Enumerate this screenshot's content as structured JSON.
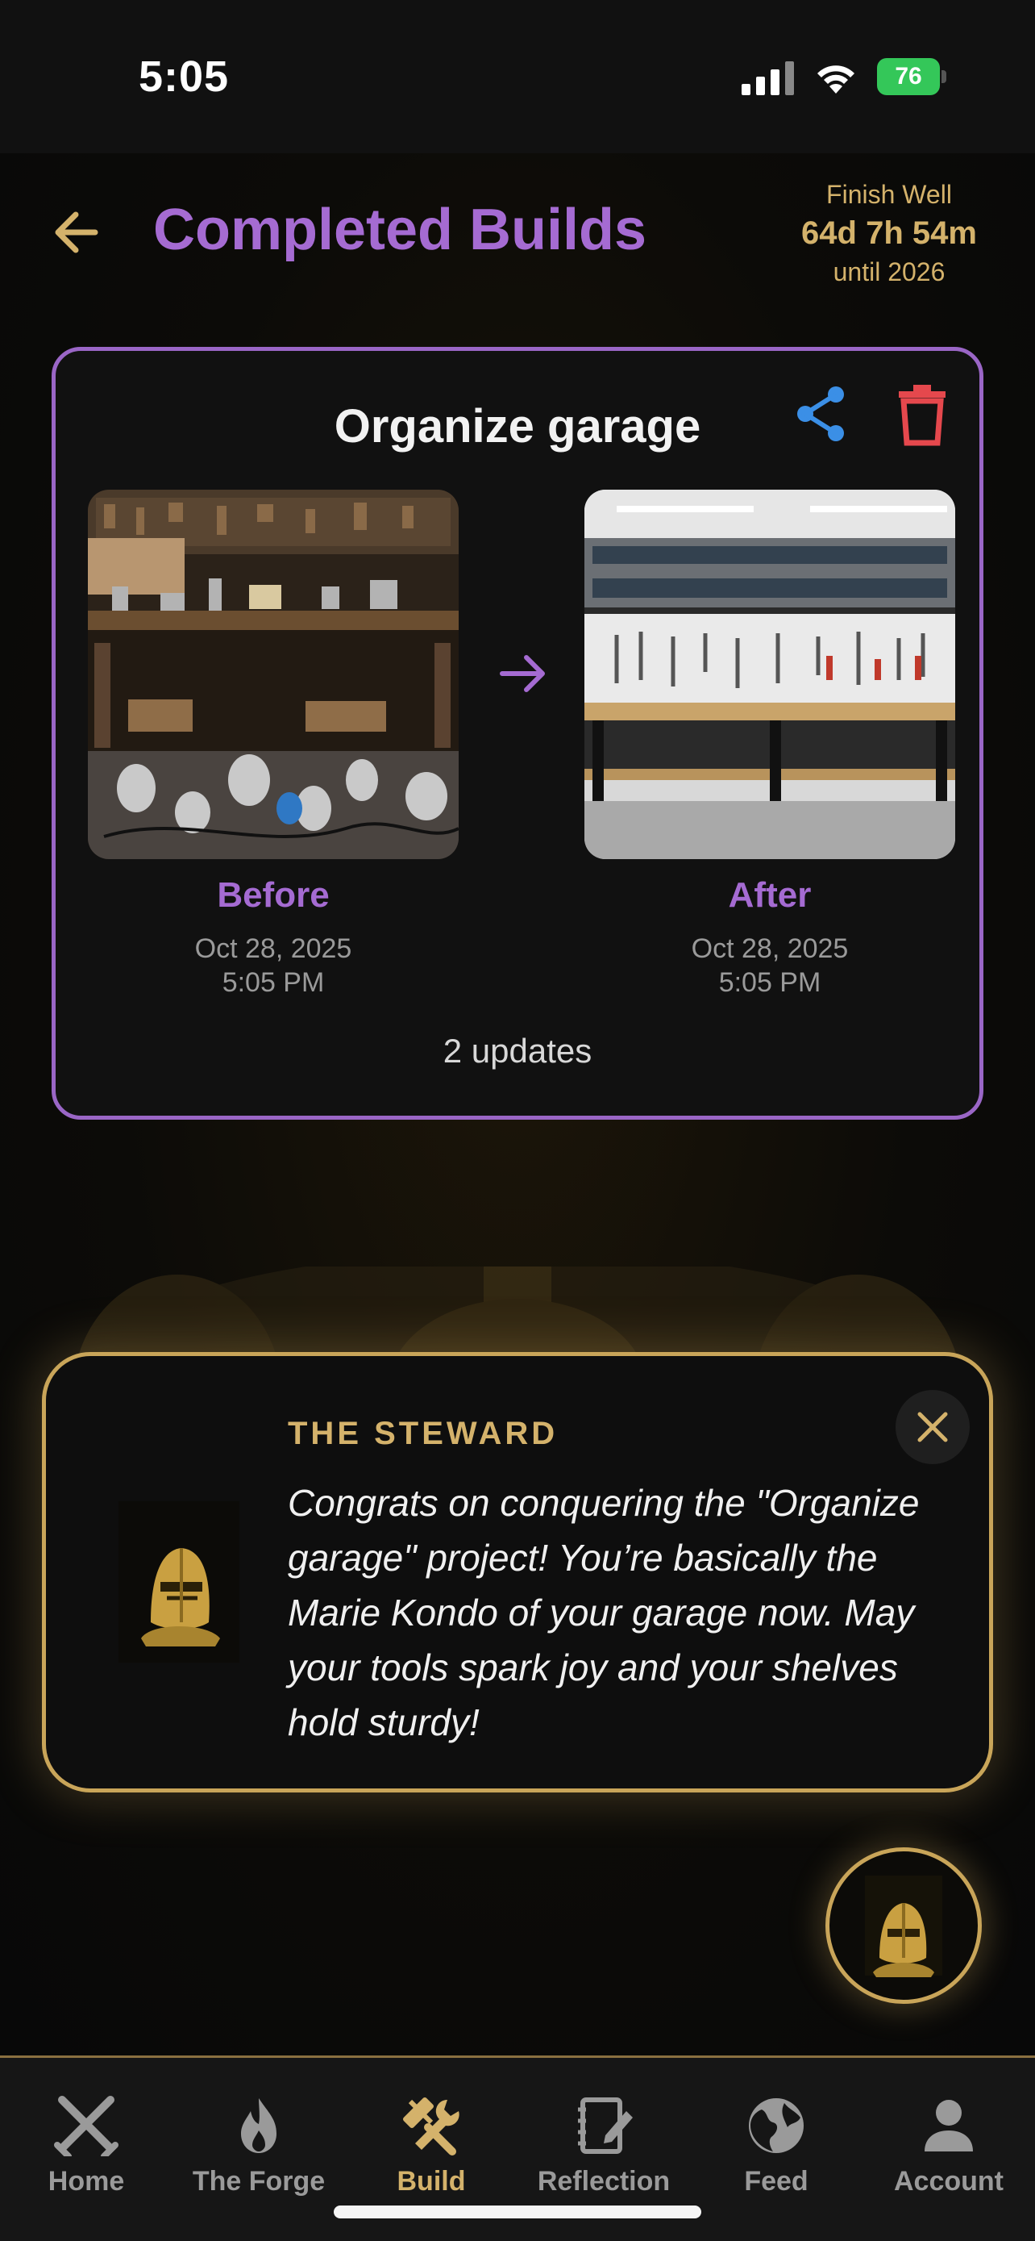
{
  "status_bar": {
    "time": "5:05",
    "battery": "76"
  },
  "header": {
    "title": "Completed Builds",
    "countdown_label": "Finish Well",
    "countdown_time": "64d 7h 54m",
    "countdown_sub": "until 2026"
  },
  "build": {
    "title": "Organize garage",
    "before_label": "Before",
    "before_date": "Oct 28, 2025",
    "before_time": "5:05 PM",
    "after_label": "After",
    "after_date": "Oct 28, 2025",
    "after_time": "5:05 PM",
    "updates": "2 updates"
  },
  "steward": {
    "name": "THE STEWARD",
    "message": "Congrats on conquering the \"Organize garage\" project! You’re basically the Marie Kondo of your garage now. May your tools spark joy and your shelves hold sturdy!"
  },
  "tabs": [
    {
      "label": "Home",
      "icon": "crossed-swords-icon"
    },
    {
      "label": "The Forge",
      "icon": "flame-icon"
    },
    {
      "label": "Build",
      "icon": "hammer-wrench-icon",
      "active": true
    },
    {
      "label": "Reflection",
      "icon": "notebook-pen-icon"
    },
    {
      "label": "Feed",
      "icon": "globe-icon"
    },
    {
      "label": "Account",
      "icon": "person-icon"
    }
  ],
  "colors": {
    "accent_purple": "#a56bd2",
    "accent_gold": "#d4b26b",
    "share_blue": "#3b8fe6",
    "delete_red": "#e5484d"
  }
}
